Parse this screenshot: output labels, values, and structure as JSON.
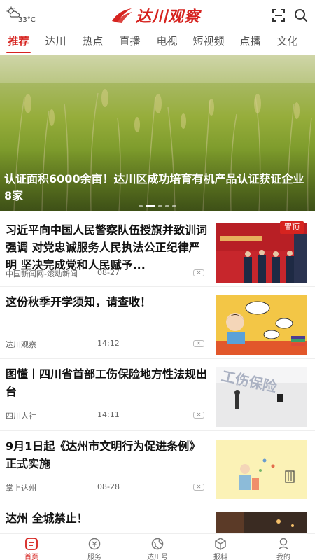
{
  "header": {
    "temperature": "33°C",
    "brand": "达川观察"
  },
  "tabs": [
    {
      "label": "推荐",
      "active": true
    },
    {
      "label": "达川"
    },
    {
      "label": "热点"
    },
    {
      "label": "直播"
    },
    {
      "label": "电视"
    },
    {
      "label": "短视频"
    },
    {
      "label": "点播"
    },
    {
      "label": "文化"
    }
  ],
  "banner": {
    "title": "认证面积6000余亩！达川区成功培育有机产品认证获证企业8家",
    "slides": 5,
    "active_slide": 2
  },
  "pin_label": "置顶",
  "news": [
    {
      "headline": "习近平向中国人民警察队伍授旗并致训词强调 对党忠诚服务人民执法公正纪律严明 坚决完成党和人民赋予...",
      "source": "中国新闻网-滚动新闻",
      "time": "08-27",
      "pinned": true
    },
    {
      "headline": "这份秋季开学须知，请查收！",
      "source": "达川观察",
      "time": "14:12"
    },
    {
      "headline": "图懂丨四川省首部工伤保险地方性法规出台",
      "source": "四川人社",
      "time": "14:11",
      "thumb_text": "工伤保险"
    },
    {
      "headline": "9月1日起《达州市文明行为促进条例》正式实施",
      "source": "掌上达州",
      "time": "08-28"
    },
    {
      "headline": "达州 全城禁止！",
      "source": "",
      "time": ""
    }
  ],
  "bottom_nav": [
    {
      "label": "首页",
      "active": true
    },
    {
      "label": "服务"
    },
    {
      "label": "达川号"
    },
    {
      "label": "报料"
    },
    {
      "label": "我的"
    }
  ],
  "colors": {
    "accent": "#d6231f"
  }
}
